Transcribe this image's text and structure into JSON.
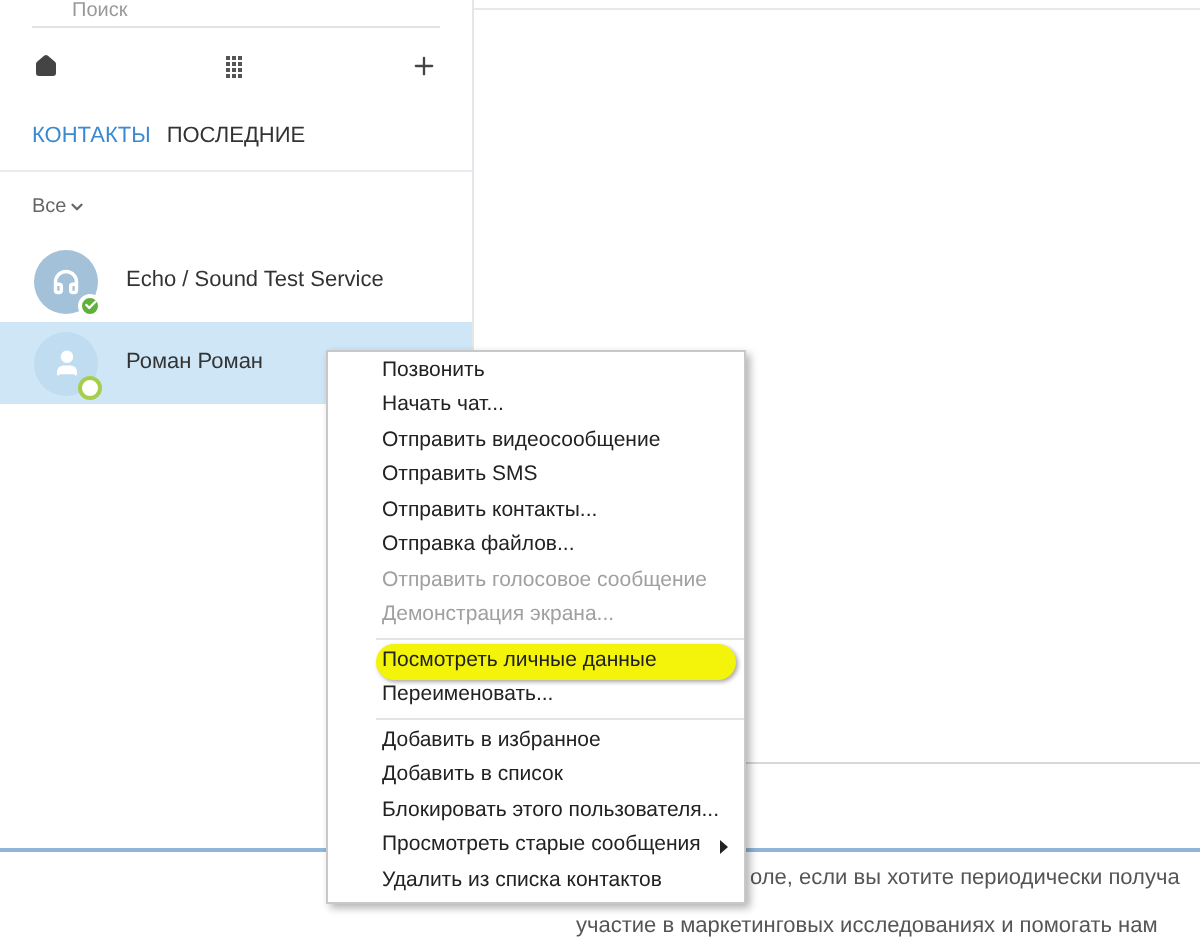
{
  "sidebar": {
    "search": {
      "placeholder": "Поиск"
    },
    "tabs": [
      {
        "label": "КОНТАКТЫ",
        "selected": true
      },
      {
        "label": "ПОСЛЕДНИЕ",
        "selected": false
      }
    ],
    "filter": {
      "label": "Все"
    },
    "contacts": [
      {
        "name": "Echo / Sound Test Service",
        "online": true,
        "selected": false,
        "kind": "service"
      },
      {
        "name": "Роман Роман",
        "online": false,
        "selected": true,
        "kind": "person"
      }
    ]
  },
  "context_menu": {
    "groups": [
      [
        {
          "label": "Позвонить",
          "disabled": false,
          "highlighted": false,
          "submenu": false
        },
        {
          "label": "Начать чат...",
          "disabled": false,
          "highlighted": false,
          "submenu": false
        },
        {
          "label": "Отправить видеосообщение",
          "disabled": false,
          "highlighted": false,
          "submenu": false
        },
        {
          "label": "Отправить SMS",
          "disabled": false,
          "highlighted": false,
          "submenu": false
        },
        {
          "label": "Отправить контакты...",
          "disabled": false,
          "highlighted": false,
          "submenu": false
        },
        {
          "label": "Отправка файлов...",
          "disabled": false,
          "highlighted": false,
          "submenu": false
        },
        {
          "label": "Отправить голосовое сообщение",
          "disabled": true,
          "highlighted": false,
          "submenu": false
        },
        {
          "label": "Демонстрация экрана...",
          "disabled": true,
          "highlighted": false,
          "submenu": false
        }
      ],
      [
        {
          "label": "Посмотреть личные данные",
          "disabled": false,
          "highlighted": true,
          "submenu": false
        },
        {
          "label": "Переименовать...",
          "disabled": false,
          "highlighted": false,
          "submenu": false
        }
      ],
      [
        {
          "label": "Добавить в избранное",
          "disabled": false,
          "highlighted": false,
          "submenu": false
        },
        {
          "label": "Добавить в список",
          "disabled": false,
          "highlighted": false,
          "submenu": false
        },
        {
          "label": "Блокировать этого пользователя...",
          "disabled": false,
          "highlighted": false,
          "submenu": false
        },
        {
          "label": "Просмотреть старые сообщения",
          "disabled": false,
          "highlighted": false,
          "submenu": true
        },
        {
          "label": "Удалить из списка контактов",
          "disabled": false,
          "highlighted": false,
          "submenu": false
        }
      ]
    ]
  },
  "footer": {
    "lines": [
      "оле, если вы хотите периодически получа",
      "участие в маркетинговых исследованиях и помогать нам"
    ]
  }
}
